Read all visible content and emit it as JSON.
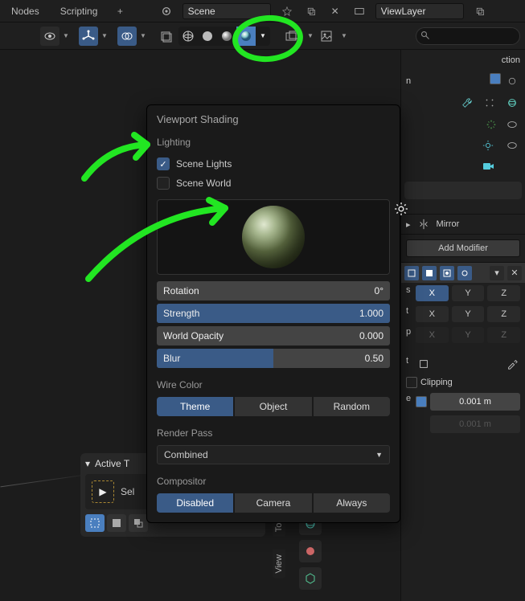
{
  "tabs": {
    "nodes": "Nodes",
    "scripting": "Scripting"
  },
  "header": {
    "scene_name": "Scene",
    "view_layer": "ViewLayer"
  },
  "toolbar": {
    "search_placeholder": ""
  },
  "popover": {
    "title": "Viewport Shading",
    "lighting_section": "Lighting",
    "scene_lights": "Scene Lights",
    "scene_world": "Scene World",
    "sliders": {
      "rotation": {
        "label": "Rotation",
        "value": "0°",
        "fill": 0
      },
      "strength": {
        "label": "Strength",
        "value": "1.000",
        "fill": 100
      },
      "world_opacity": {
        "label": "World Opacity",
        "value": "0.000",
        "fill": 0
      },
      "blur": {
        "label": "Blur",
        "value": "0.50",
        "fill": 50
      }
    },
    "wire_section": "Wire Color",
    "wire_options": [
      "Theme",
      "Object",
      "Random"
    ],
    "render_pass_section": "Render Pass",
    "render_pass_value": "Combined",
    "compositor_section": "Compositor",
    "compositor_options": [
      "Disabled",
      "Camera",
      "Always"
    ]
  },
  "right": {
    "collection_fragment": "ction",
    "obj_fragment": "n",
    "mirror_label": "Mirror",
    "add_modifier": "Add Modifier",
    "axis_x": "X",
    "axis_y": "Y",
    "axis_z": "Z",
    "clipping": "Clipping",
    "merge_e_fragment": "e",
    "merge_val": "0.001 m",
    "bisect_val": "0.001 m"
  },
  "active_tool": {
    "header": "Active T",
    "select": "Sel"
  },
  "vert": {
    "tool": "Tool",
    "view": "View"
  }
}
